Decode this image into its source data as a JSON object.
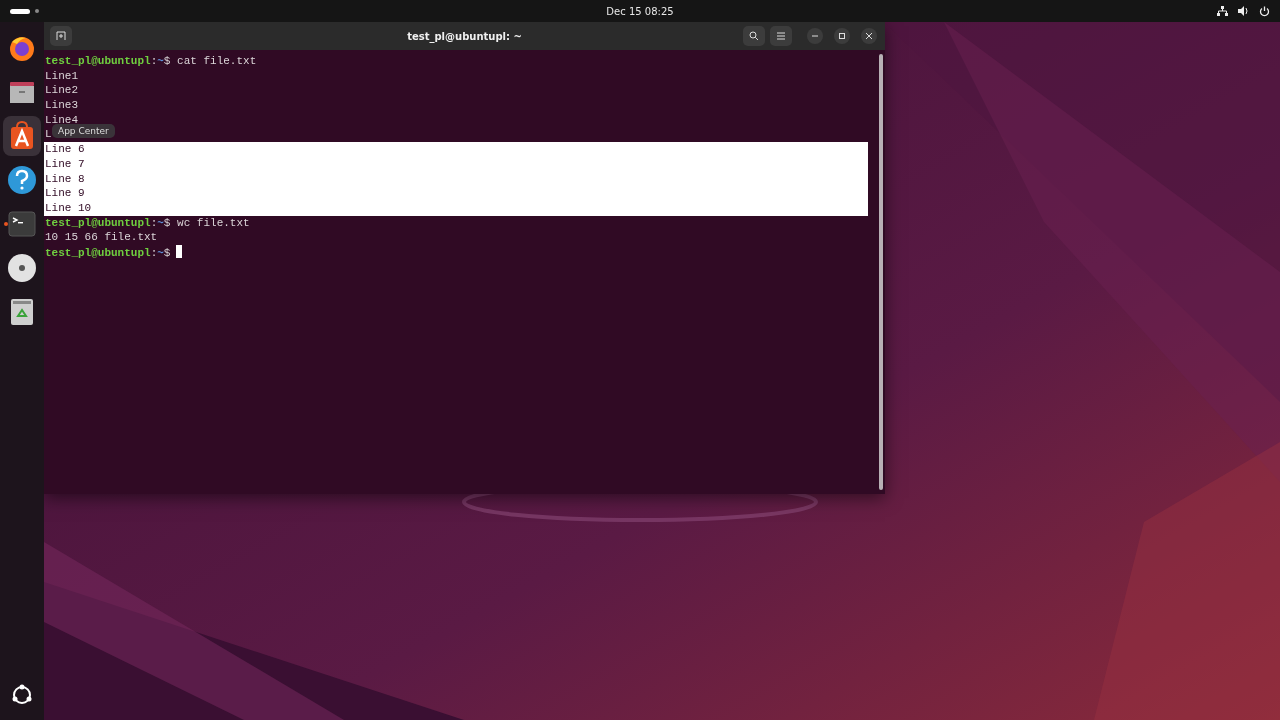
{
  "top_bar": {
    "clock": "Dec 15  08:25"
  },
  "dock": [
    {
      "kind": "browser",
      "running": false,
      "hovered": false
    },
    {
      "kind": "files",
      "running": false,
      "hovered": false
    },
    {
      "kind": "store",
      "running": false,
      "hovered": true
    },
    {
      "kind": "help",
      "running": false,
      "hovered": false
    },
    {
      "kind": "terminal",
      "running": true,
      "hovered": false
    },
    {
      "kind": "disc",
      "running": false,
      "hovered": false
    },
    {
      "kind": "trash",
      "running": false,
      "hovered": false
    }
  ],
  "tooltip": "App Center",
  "window": {
    "title": "test_pl@ubuntupl: ~",
    "lines": [
      {
        "kind": "prompt",
        "user": "test_pl@ubuntupl",
        "sep": ":",
        "path": "~",
        "sign": "$",
        "command": "cat file.txt",
        "cursor": false,
        "selected": false
      },
      {
        "kind": "output",
        "text": "Line1",
        "selected": false
      },
      {
        "kind": "output",
        "text": "Line2",
        "selected": false
      },
      {
        "kind": "output",
        "text": "Line3",
        "selected": false
      },
      {
        "kind": "output",
        "text": "Line4",
        "selected": false
      },
      {
        "kind": "output",
        "text": "L",
        "selected": false
      },
      {
        "kind": "output",
        "text": "Line 6",
        "selected": true
      },
      {
        "kind": "output",
        "text": "Line 7",
        "selected": true
      },
      {
        "kind": "output",
        "text": "Line 8",
        "selected": true
      },
      {
        "kind": "output",
        "text": "Line 9",
        "selected": true
      },
      {
        "kind": "output",
        "text": "Line 10",
        "selected": true
      },
      {
        "kind": "prompt",
        "user": "test_pl@ubuntupl",
        "sep": ":",
        "path": "~",
        "sign": "$",
        "command": "wc file.txt",
        "cursor": false,
        "selected": false
      },
      {
        "kind": "output",
        "text": "10 15 66 file.txt",
        "selected": false
      },
      {
        "kind": "prompt",
        "user": "test_pl@ubuntupl",
        "sep": ":",
        "path": "~",
        "sign": "$",
        "cursor": true,
        "selected": false
      }
    ]
  }
}
